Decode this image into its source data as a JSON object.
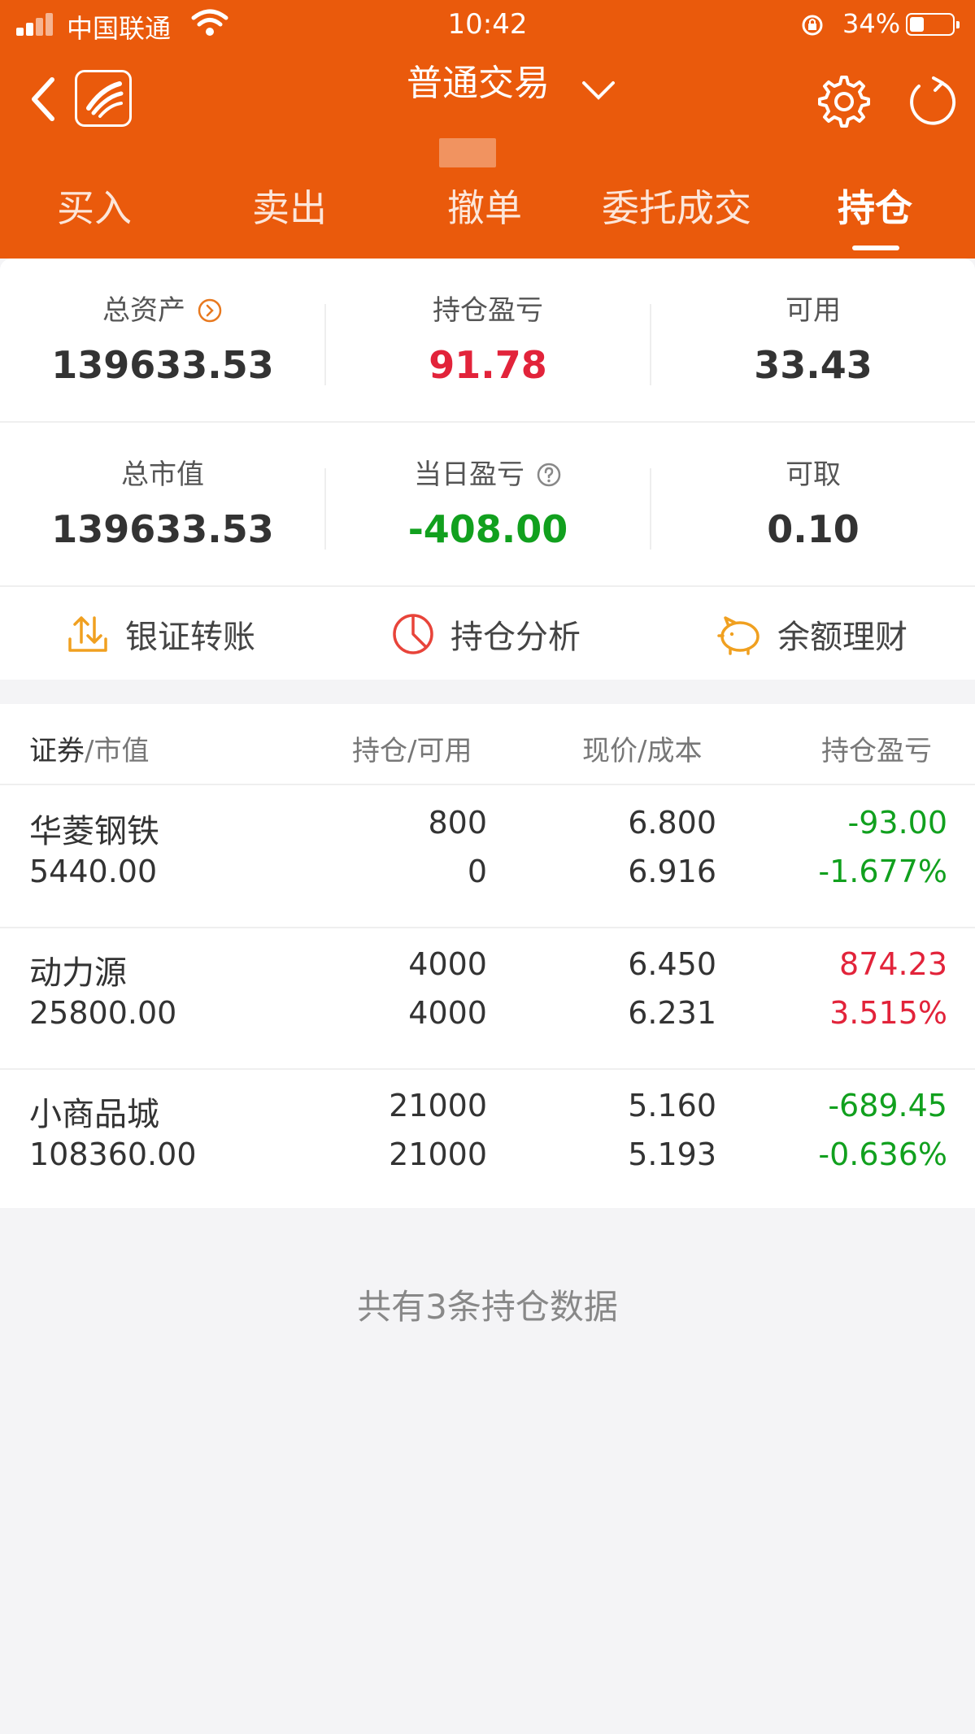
{
  "status_bar": {
    "carrier": "中国联通",
    "time": "10:42",
    "battery": "34%",
    "battery_level": 0.34
  },
  "header": {
    "title": "普通交易",
    "tabs": [
      {
        "label": "买入",
        "active": false
      },
      {
        "label": "卖出",
        "active": false
      },
      {
        "label": "撤单",
        "active": false
      },
      {
        "label": "委托成交",
        "active": false
      },
      {
        "label": "持仓",
        "active": true
      }
    ]
  },
  "summary": {
    "total_assets": {
      "label": "总资产",
      "value": "139633.53"
    },
    "position_pnl": {
      "label": "持仓盈亏",
      "value": "91.78"
    },
    "available": {
      "label": "可用",
      "value": "33.43"
    },
    "market_value": {
      "label": "总市值",
      "value": "139633.53"
    },
    "daily_pnl": {
      "label": "当日盈亏",
      "value": "-408.00"
    },
    "withdrawable": {
      "label": "可取",
      "value": "0.10"
    }
  },
  "actions": [
    {
      "label": "银证转账",
      "icon": "transfer-icon"
    },
    {
      "label": "持仓分析",
      "icon": "pie-chart-icon"
    },
    {
      "label": "余额理财",
      "icon": "piggy-bank-icon"
    }
  ],
  "table": {
    "headers": {
      "security": "证券",
      "security_sub": "/市值",
      "position": "持仓/可用",
      "price": "现价/成本",
      "pnl": "持仓盈亏"
    },
    "rows": [
      {
        "name": "华菱钢铁",
        "market_value": "5440.00",
        "position": "800",
        "available": "0",
        "price": "6.800",
        "cost": "6.916",
        "pnl": "-93.00",
        "pnl_pct": "-1.677%",
        "trend": "down"
      },
      {
        "name": "动力源",
        "market_value": "25800.00",
        "position": "4000",
        "available": "4000",
        "price": "6.450",
        "cost": "6.231",
        "pnl": "874.23",
        "pnl_pct": "3.515%",
        "trend": "up"
      },
      {
        "name": "小商品城",
        "market_value": "108360.00",
        "position": "21000",
        "available": "21000",
        "price": "5.160",
        "cost": "5.193",
        "pnl": "-689.45",
        "pnl_pct": "-0.636%",
        "trend": "down"
      }
    ]
  },
  "footer_note": "共有3条持仓数据",
  "colors": {
    "brand": "#ea5a0c",
    "gain": "#e2233a",
    "loss": "#11a01e"
  }
}
